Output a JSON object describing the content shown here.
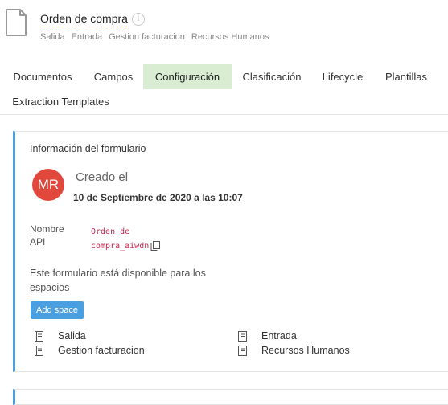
{
  "header": {
    "title": "Orden de compra",
    "info_icon": "info-icon",
    "spaces": [
      "Salida",
      "Entrada",
      "Gestion facturacion",
      "Recursos Humanos"
    ]
  },
  "tabs": [
    {
      "label": "Documentos",
      "active": false
    },
    {
      "label": "Campos",
      "active": false
    },
    {
      "label": "Configuración",
      "active": true
    },
    {
      "label": "Clasificación",
      "active": false
    },
    {
      "label": "Lifecycle",
      "active": false
    },
    {
      "label": "Plantillas",
      "active": false
    },
    {
      "label": "Extraction Templates",
      "active": false
    }
  ],
  "form_info": {
    "title": "Información del formulario",
    "avatar_initials": "MR",
    "created_label": "Creado el",
    "created_date": "10 de Septiembre de 2020 a las 10:07",
    "name_label": "Nombre",
    "api_label": "API",
    "api_value_line1": "Orden de",
    "api_value_line2": "compra_aiwdn",
    "availability_text": "Este formulario está disponible para los espacios",
    "add_space_label": "Add space",
    "spaces": [
      "Salida",
      "Entrada",
      "Gestion facturacion",
      "Recursos Humanos"
    ]
  },
  "colors": {
    "accent": "#4a9fe0",
    "active_tab_bg": "#d9edd3",
    "avatar_bg": "#e2473b",
    "code_text": "#c7254e"
  }
}
